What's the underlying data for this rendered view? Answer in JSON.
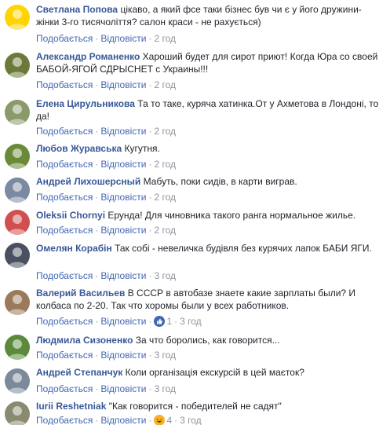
{
  "actions": {
    "like": "Подобається",
    "reply": "Відповісти"
  },
  "comments": [
    {
      "author": "Светлана Попова",
      "text": "цікаво, а який фсе таки бізнес був чи є у його дружини-жінки 3-го тисячоліття? салон краси - не рахується)",
      "time": "2 год",
      "avatar_color": "#ffd400"
    },
    {
      "author": "Александр Романенко",
      "text": "Хароший будет для сирот приют! Когда Юра со своей БАБОЙ-ЯГОЙ СДРЫСНЕТ с Украины!!!",
      "time": "2 год",
      "avatar_color": "#6b7a3a"
    },
    {
      "author": "Елена Цирульникова",
      "text": "Та то таке, куряча хатинка.От у Ахметова в Лондоні, то да!",
      "time": "2 год",
      "avatar_color": "#8a9a6a"
    },
    {
      "author": "Любов Журавська",
      "text": "Кугутня.",
      "time": "2 год",
      "avatar_color": "#6a8a3a"
    },
    {
      "author": "Андрей Лихошерсный",
      "text": "Мабуть, поки сидів, в карти виграв.",
      "time": "2 год",
      "avatar_color": "#7a8aa0"
    },
    {
      "author": "Oleksii Chornyi",
      "text": "Ерунда! Для чиновника такого ранга нормальное жилье.",
      "time": "2 год",
      "avatar_color": "#d05050"
    },
    {
      "author": "Омелян Корабін",
      "text": "Так собі - невеличка будівля без курячих лапок БАБИ ЯГИ.",
      "time": "3 год",
      "avatar_color": "#4a5060"
    },
    {
      "author": "Валерий Васильев",
      "text": "В СССР в автобазе знаете какие зарплаты были? И колбаса по 2-20. Так что хоромы были у всех работников.",
      "time": "3 год",
      "avatar_color": "#9a7a5a",
      "reaction": "like",
      "reaction_count": "1"
    },
    {
      "author": "Людмила Сизоненко",
      "text": "За что боролись, как говорится...",
      "time": "3 год",
      "avatar_color": "#5a8a3a"
    },
    {
      "author": "Андрей Степанчук",
      "text": "Коли організація екскурсій в цей маєток?",
      "time": "3 год",
      "avatar_color": "#7a8a9a"
    },
    {
      "author": "Iurii Reshetniak",
      "text": "\"Как говорится - победителей не садят\"",
      "time": "3 год",
      "avatar_color": "#8a8a70",
      "reaction": "haha",
      "reaction_count": "4"
    }
  ]
}
